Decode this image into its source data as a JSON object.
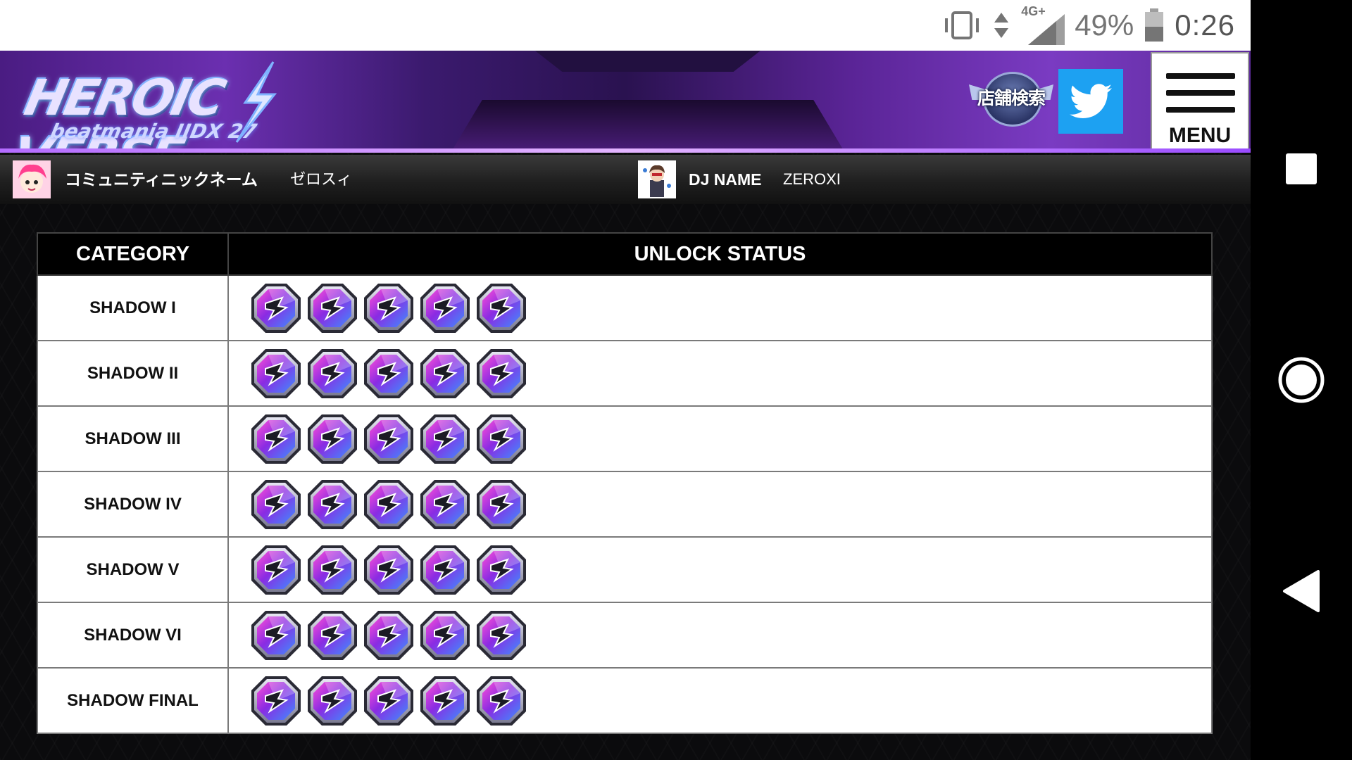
{
  "status_bar": {
    "network": "4G+",
    "battery": "49%",
    "time": "0:26"
  },
  "header": {
    "logo_main": "HEROIC VERSE",
    "logo_sub": "beatmania IIDX 27",
    "store_search_label": "店舗検索",
    "menu_label": "MENU"
  },
  "user": {
    "community_label": "コミュニティニックネーム",
    "community_value": "ゼロスィ",
    "dj_label": "DJ NAME",
    "dj_value": "ZEROXI"
  },
  "table": {
    "headers": [
      "CATEGORY",
      "UNLOCK STATUS"
    ],
    "rows": [
      {
        "category": "SHADOW I",
        "unlocked": 5
      },
      {
        "category": "SHADOW II",
        "unlocked": 5
      },
      {
        "category": "SHADOW III",
        "unlocked": 5
      },
      {
        "category": "SHADOW IV",
        "unlocked": 5
      },
      {
        "category": "SHADOW V",
        "unlocked": 5
      },
      {
        "category": "SHADOW VI",
        "unlocked": 5
      },
      {
        "category": "SHADOW FINAL",
        "unlocked": 5
      }
    ]
  },
  "colors": {
    "banner_purple": "#6b2fb0",
    "twitter_blue": "#1da1f2",
    "gem_purple": "#8a2be2"
  },
  "icons": {
    "status_bar": [
      "vibrate-icon",
      "data-arrows-icon",
      "signal-icon",
      "battery-icon"
    ],
    "nav_bar": [
      "recents-square-icon",
      "home-circle-icon",
      "back-triangle-icon"
    ],
    "gem": "sr-gem-icon"
  }
}
